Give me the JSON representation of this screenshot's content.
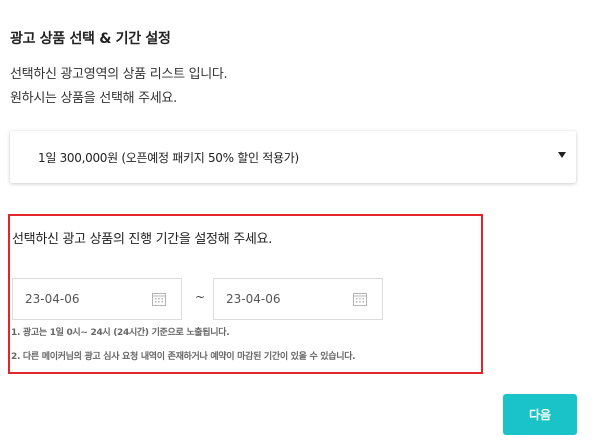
{
  "section": {
    "title": "광고 상품 선택 & 기간 설정",
    "description_lines": [
      "선택하신 광고영역의 상품 리스트 입니다.",
      "원하시는 상품을 선택해 주세요."
    ]
  },
  "product_select": {
    "selected_value": "1일 300,000원 (오픈예정 패키지 50% 할인 적용가)",
    "arrow_icon": "caret-down-icon"
  },
  "period": {
    "heading": "선택하신 광고 상품의 진행 기간을 설정해 주세요.",
    "start_date": "23-04-06",
    "end_date": "23-04-06",
    "separator": "~",
    "calendar_icon": "calendar-icon",
    "notes": [
      "1. 광고는 1일 0시~ 24시 (24시간) 기준으로 노출됩니다.",
      "2. 다른 메이커님의 광고 심사 요청 내역이 존재하거나 예약이 마감된 기간이 있을 수 있습니다."
    ],
    "highlight_color": "#e0262a"
  },
  "actions": {
    "next_label": "다음",
    "next_color": "#19c3c7"
  }
}
